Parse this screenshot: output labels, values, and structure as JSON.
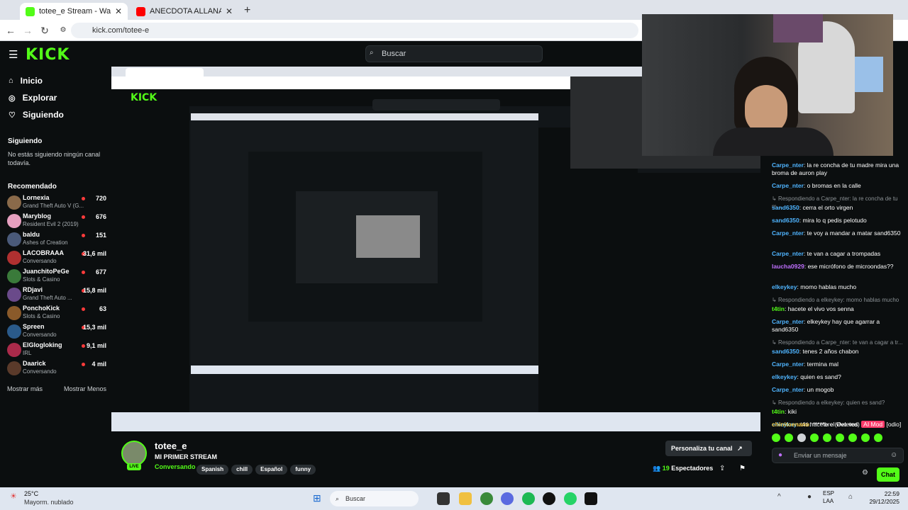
{
  "browser": {
    "tabs": [
      {
        "title": "totee_e Stream - Watch Live o",
        "active": true,
        "favicon_color": "#53fc18"
      },
      {
        "title": "ANECDOTA ALLANAMIENTO A",
        "active": false,
        "favicon_color": "#ff0000"
      }
    ],
    "url": "kick.com/totee-e"
  },
  "header": {
    "logo": "KICK",
    "search_placeholder": "Buscar"
  },
  "sidebar": {
    "nav": [
      {
        "label": "Inicio",
        "icon": "home-icon"
      },
      {
        "label": "Explorar",
        "icon": "compass-icon"
      },
      {
        "label": "Siguiendo",
        "icon": "heart-icon"
      }
    ],
    "following_title": "Siguiendo",
    "following_empty": "No estás siguiendo ningún canal todavía.",
    "recommended_title": "Recomendado",
    "recommended": [
      {
        "name": "Lornexia",
        "game": "Grand Theft Auto V (G...",
        "viewers": "720",
        "color": "#8a6a4a"
      },
      {
        "name": "Maryblog",
        "game": "Resident Evil 2 (2019)",
        "viewers": "676",
        "color": "#e6a0c0"
      },
      {
        "name": "baldu",
        "game": "Ashes of Creation",
        "viewers": "151",
        "color": "#4a5a7a"
      },
      {
        "name": "LACOBRAAA",
        "game": "Conversando",
        "viewers": "31,6 mil",
        "color": "#b03030"
      },
      {
        "name": "JuanchitoPeGe",
        "game": "Slots & Casino",
        "viewers": "677",
        "color": "#3a7a3a"
      },
      {
        "name": "RDjavi",
        "game": "Grand Theft Auto ...",
        "viewers": "15,8 mil",
        "color": "#6a4a8a"
      },
      {
        "name": "PonchoKick",
        "game": "Slots & Casino",
        "viewers": "63",
        "color": "#8a5a2a"
      },
      {
        "name": "Spreen",
        "game": "Conversando",
        "viewers": "15,3 mil",
        "color": "#2a5a8a"
      },
      {
        "name": "ElGlogloking",
        "game": "IRL",
        "viewers": "9,1 mil",
        "color": "#aa2a4a"
      },
      {
        "name": "Daarick",
        "game": "Conversando",
        "viewers": "4 mil",
        "color": "#5a3a2a"
      }
    ],
    "show_more": "Mostrar más",
    "show_less": "Mostrar Menos"
  },
  "stream": {
    "channel": "totee_e",
    "title": "MI PRIMER STREAM",
    "category": "Conversando",
    "live_badge": "LIVE",
    "tags": [
      "Spanish",
      "chill",
      "Español",
      "funny"
    ],
    "customize_button": "Personaliza tu canal",
    "viewers": "19",
    "viewers_label": "Espectadores"
  },
  "chat": {
    "messages": [
      {
        "type": "msg",
        "user": "Carpe_nter",
        "user_color": "#4fb4ff",
        "text": "la re concha de tu madre mira una broma de auron play"
      },
      {
        "type": "msg",
        "user": "Carpe_nter",
        "user_color": "#4fb4ff",
        "text": "o bromas en la calle"
      },
      {
        "type": "reply",
        "text": "Respondiendo a Carpe_nter: la re concha de tu m..."
      },
      {
        "type": "msg",
        "user": "sand6350",
        "user_color": "#4fb4ff",
        "text": "cerra el orto virgen"
      },
      {
        "type": "msg",
        "user": "sand6350",
        "user_color": "#4fb4ff",
        "text": "mira lo q pedis pelotudo"
      },
      {
        "type": "msg",
        "user": "Carpe_nter",
        "user_color": "#4fb4ff",
        "text": "te voy a mandar a matar sand6350"
      },
      {
        "type": "msg",
        "user": "Carpe_nter",
        "user_color": "#4fb4ff",
        "text": "te van a cagar a trompadas"
      },
      {
        "type": "msg",
        "user": "laucha0929",
        "user_color": "#c070ff",
        "text": "ese micrófono de microondas??"
      },
      {
        "type": "msg",
        "user": "elkeykey",
        "user_color": "#4fb4ff",
        "text": "momo hablas mucho"
      },
      {
        "type": "reply",
        "text": "Respondiendo a elkeykey: momo hablas mucho"
      },
      {
        "type": "msg",
        "user": "t4tin",
        "user_color": "#53fc18",
        "text": "hacete el vivo vos senna"
      },
      {
        "type": "msg",
        "user": "Carpe_nter",
        "user_color": "#4fb4ff",
        "text": "elkeykey hay que agarrar a sand6350"
      },
      {
        "type": "reply",
        "text": "Respondiendo a Carpe_nter: te van a cagar a tr..."
      },
      {
        "type": "msg",
        "user": "sand6350",
        "user_color": "#4fb4ff",
        "text": "tenes 2 años chabon"
      },
      {
        "type": "msg",
        "user": "Carpe_nter",
        "user_color": "#4fb4ff",
        "text": "termina mal"
      },
      {
        "type": "msg",
        "user": "elkeykey",
        "user_color": "#4fb4ff",
        "text": "quien es sand?"
      },
      {
        "type": "msg",
        "user": "Carpe_nter",
        "user_color": "#4fb4ff",
        "text": "un mogob"
      },
      {
        "type": "reply",
        "text": "Respondiendo a elkeykey: quien es sand?"
      },
      {
        "type": "msg",
        "user": "t4tin",
        "user_color": "#53fc18",
        "text": "kiki"
      },
      {
        "type": "msg",
        "user": "elkeykey",
        "user_color": "#4fb4ff",
        "text": "t4ti hacete el vivo vos"
      },
      {
        "type": "msg",
        "user": "chinitoenano",
        "user_color": "#ffd24a",
        "text": "*****bre (Deleted)"
      }
    ],
    "mod_badge": "AI Mod",
    "mod_extra": "[odio]",
    "input_placeholder": "Enviar un mensaje",
    "send_button": "Chat"
  },
  "taskbar": {
    "weather_temp": "25°C",
    "weather_desc": "Mayorm. nublado",
    "search": "Buscar",
    "lang1": "ESP",
    "lang2": "LAA",
    "time": "22:59",
    "date": "29/12/2025"
  }
}
